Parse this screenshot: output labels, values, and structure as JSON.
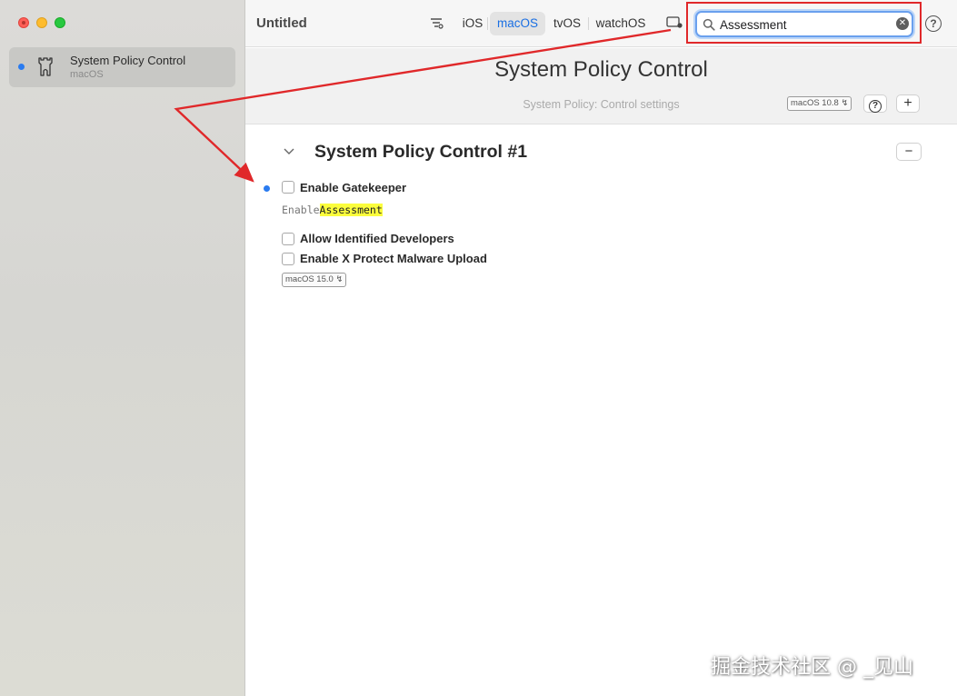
{
  "sidebar": {
    "items": [
      {
        "title": "System Policy Control",
        "subtitle": "macOS",
        "icon": "tower-icon"
      }
    ]
  },
  "toolbar": {
    "title": "Untitled",
    "platforms": [
      "iOS",
      "macOS",
      "tvOS",
      "watchOS"
    ],
    "selected_platform": "macOS",
    "search": {
      "value": "Assessment",
      "placeholder": "Search"
    },
    "clear_glyph": "✕",
    "help_glyph": "?"
  },
  "payload": {
    "title": "System Policy Control",
    "subtitle": "System Policy: Control settings",
    "version_badge": "macOS  10.8 ↯",
    "help_glyph": "?",
    "add_glyph": "+"
  },
  "section": {
    "title": "System Policy Control #1",
    "remove_glyph": "−",
    "options": [
      {
        "label": "Enable Gatekeeper",
        "key_prefix": "Enable",
        "key_highlight": "Assessment",
        "checked": false,
        "modified": true
      },
      {
        "label": "Allow Identified Developers",
        "checked": false
      },
      {
        "label": "Enable X Protect Malware Upload",
        "checked": false
      }
    ],
    "version_badge": "macOS  15.0 ↯"
  },
  "watermark": "掘金技术社区 @ _见山",
  "colors": {
    "accent": "#1a6fe3",
    "annotation": "#e0282a",
    "highlight": "#fbfd3c",
    "dot": "#2a7bf0"
  }
}
